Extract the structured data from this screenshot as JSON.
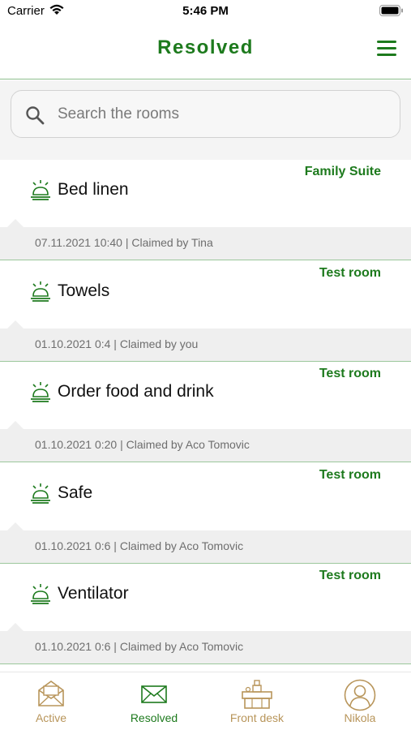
{
  "status_bar": {
    "carrier": "Carrier",
    "time": "5:46 PM"
  },
  "header": {
    "title": "Resolved"
  },
  "search": {
    "placeholder": "Search the rooms"
  },
  "requests": [
    {
      "room": "Family Suite",
      "name": "Bed linen",
      "meta": "07.11.2021 10:40 | Claimed by Tina"
    },
    {
      "room": "Test room",
      "name": "Towels",
      "meta": "01.10.2021 0:4 | Claimed by you"
    },
    {
      "room": "Test room",
      "name": "Order food and drink",
      "meta": "01.10.2021 0:20 | Claimed by Aco Tomovic"
    },
    {
      "room": "Test room",
      "name": "Safe",
      "meta": "01.10.2021 0:6 | Claimed by Aco Tomovic"
    },
    {
      "room": "Test room",
      "name": "Ventilator",
      "meta": "01.10.2021 0:6 | Claimed by Aco Tomovic"
    }
  ],
  "tabs": [
    {
      "label": "Active",
      "icon": "open-envelope-icon",
      "color": "#b8955a"
    },
    {
      "label": "Resolved",
      "icon": "envelope-icon",
      "color": "#1d7a1d"
    },
    {
      "label": "Front desk",
      "icon": "front-desk-icon",
      "color": "#b8955a"
    },
    {
      "label": "Nikola",
      "icon": "user-icon",
      "color": "#b8955a"
    }
  ],
  "colors": {
    "accent": "#1d7a1d",
    "tab_inactive": "#b8955a",
    "meta_bg": "#efefef"
  }
}
